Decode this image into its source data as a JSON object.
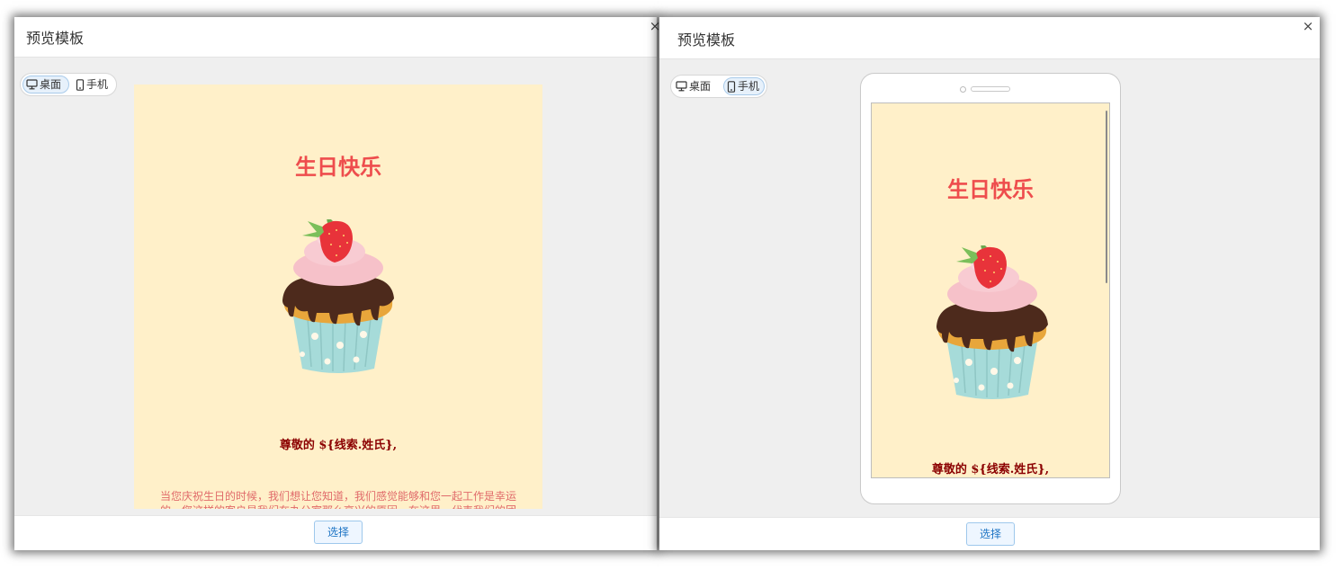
{
  "left_dialog": {
    "title": "预览模板",
    "close": "×",
    "toggle": {
      "desktop": "桌面",
      "mobile": "手机",
      "active": "desktop"
    },
    "card": {
      "title": "生日快乐",
      "greeting": "尊敬的 ${线索.姓氏},",
      "paragraph": "当您庆祝生日的时候，我们想让您知道，我们感觉能够和您一起工作是幸运的。您这样的客户是我们在办公室那么高兴的原因。在这里，代表我们的团"
    },
    "select_label": "选择"
  },
  "right_dialog": {
    "title": "预览模板",
    "close": "×",
    "toggle": {
      "desktop": "桌面",
      "mobile": "手机",
      "active": "mobile"
    },
    "card": {
      "title": "生日快乐",
      "greeting": "尊敬的 ${线索.姓氏},"
    },
    "select_label": "选择"
  },
  "colors": {
    "card_background": "#fff0c9",
    "title_red": "#ee4d4d",
    "greeting_dark_red": "#8b0000",
    "button_blue": "#1d74c4"
  },
  "icons": {
    "desktop": "monitor-icon",
    "mobile": "phone-icon",
    "close": "close-icon",
    "cupcake": "cupcake-image"
  }
}
